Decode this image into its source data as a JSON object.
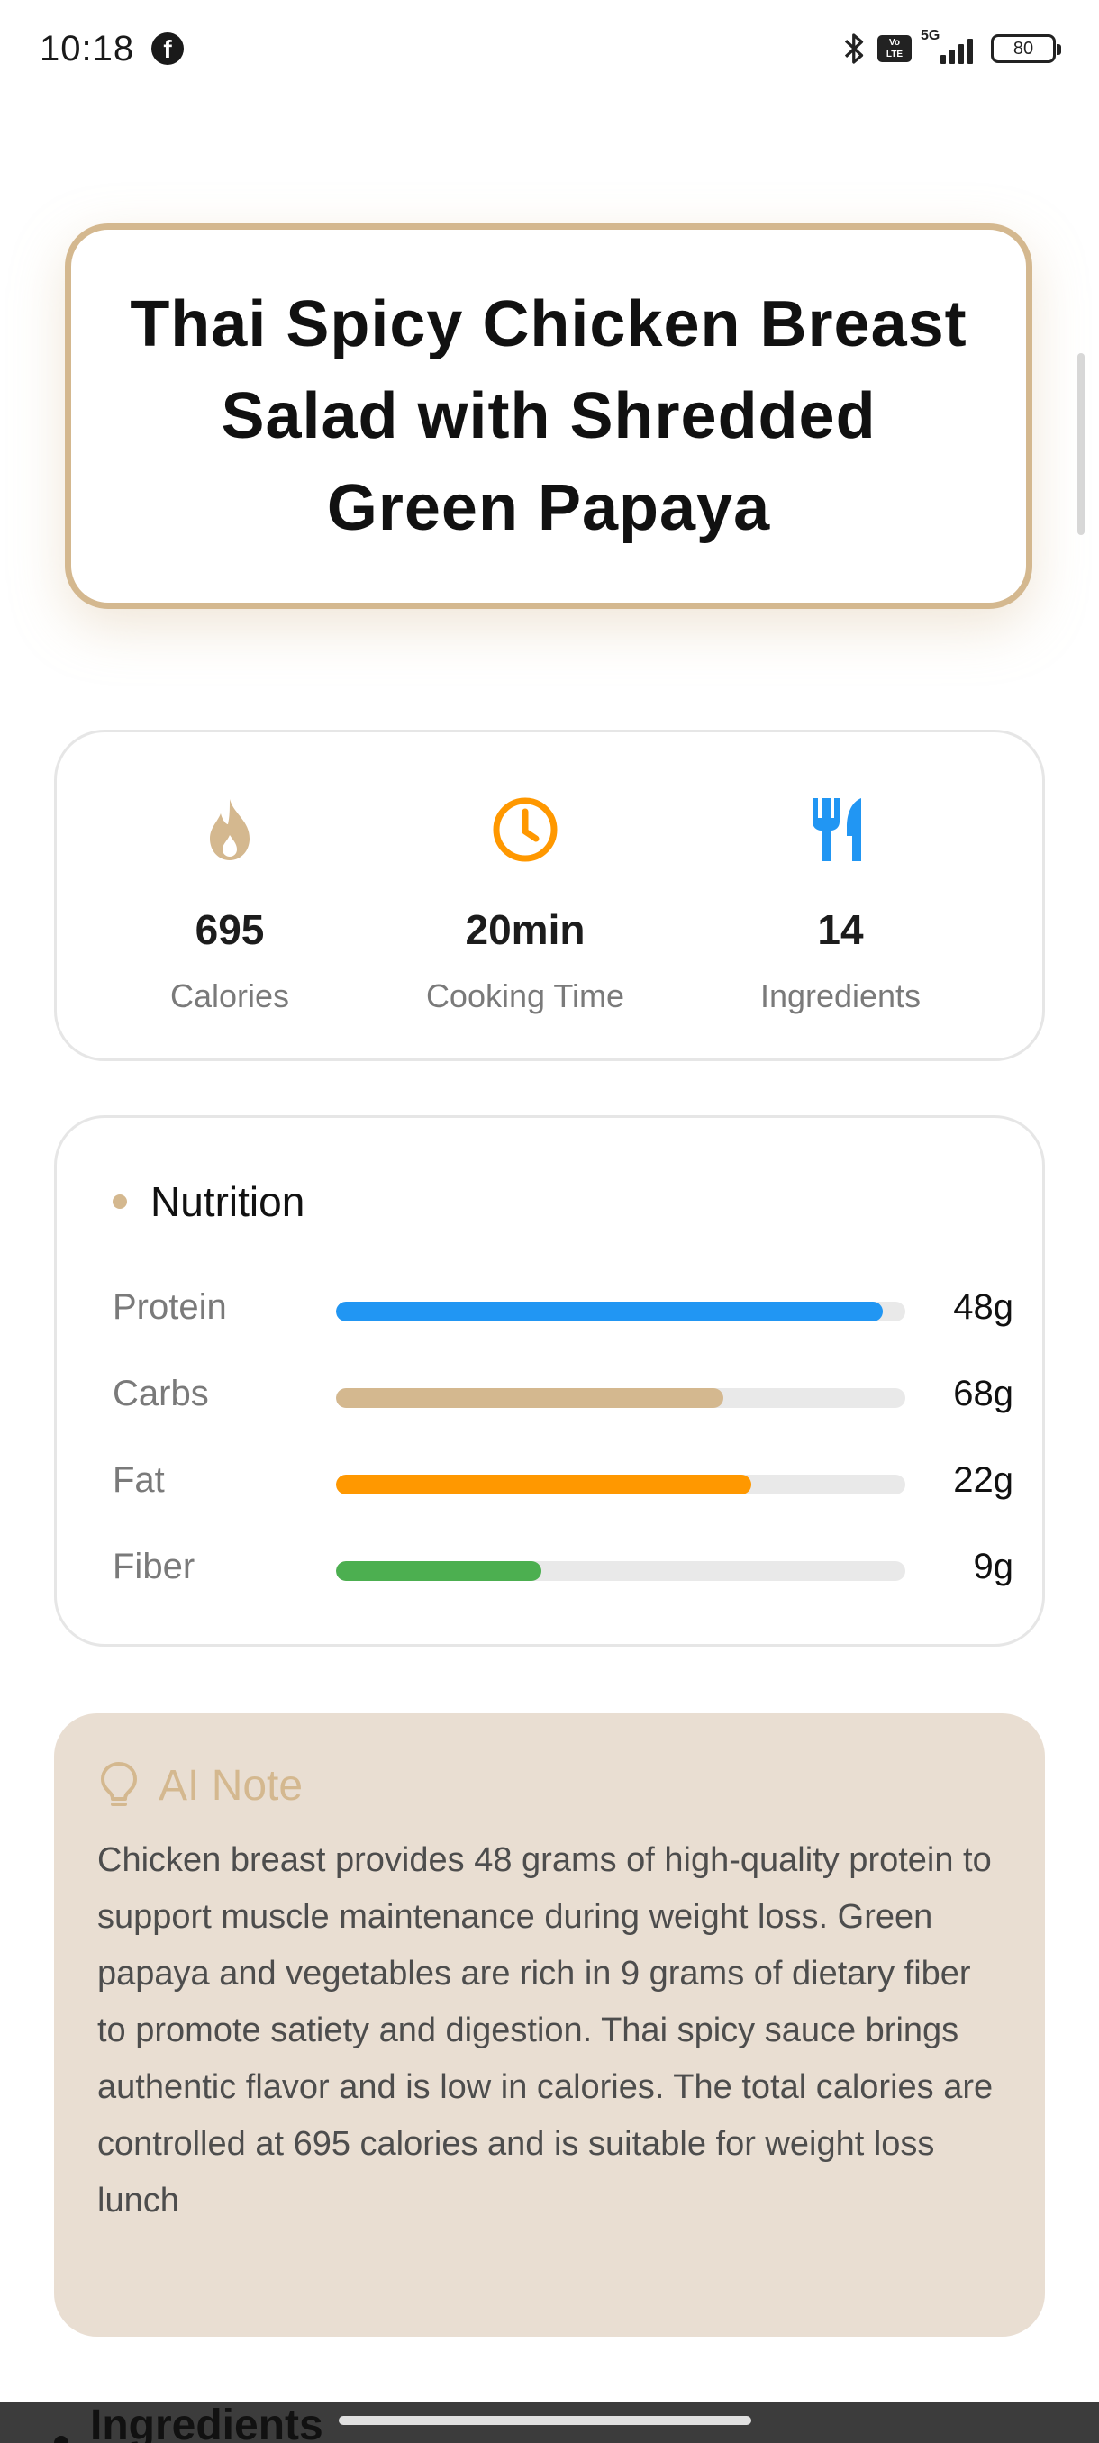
{
  "status_bar": {
    "time": "10:18",
    "battery": "80"
  },
  "title": "Thai Spicy Chicken Breast Salad with Shredded Green Papaya",
  "stats": [
    {
      "icon": "flame-icon",
      "value": "695",
      "label": "Calories",
      "color": "#d4b88f"
    },
    {
      "icon": "clock-icon",
      "value": "20min",
      "label": "Cooking Time",
      "color": "#ff9800"
    },
    {
      "icon": "utensils-icon",
      "value": "14",
      "label": "Ingredients",
      "color": "#2196f3"
    }
  ],
  "nutrition": {
    "title": "Nutrition",
    "items": [
      {
        "label": "Protein",
        "value": "48g",
        "fraction": 0.96,
        "color": "#2196f3"
      },
      {
        "label": "Carbs",
        "value": "68g",
        "fraction": 0.68,
        "color": "#d4b88f"
      },
      {
        "label": "Fat",
        "value": "22g",
        "fraction": 0.73,
        "color": "#ff9800"
      },
      {
        "label": "Fiber",
        "value": "9g",
        "fraction": 0.36,
        "color": "#4caf50"
      }
    ]
  },
  "ai_note": {
    "title": "AI Note",
    "text": "Chicken breast provides 48 grams of high-quality protein to support muscle maintenance during weight loss. Green papaya and vegetables are rich in 9 grams of dietary fiber to promote satiety and digestion. Thai spicy sauce brings authentic flavor and is low in calories. The total calories are controlled at 695 calories and is suitable for weight loss lunch"
  },
  "ingredients_heading": "Ingredients"
}
